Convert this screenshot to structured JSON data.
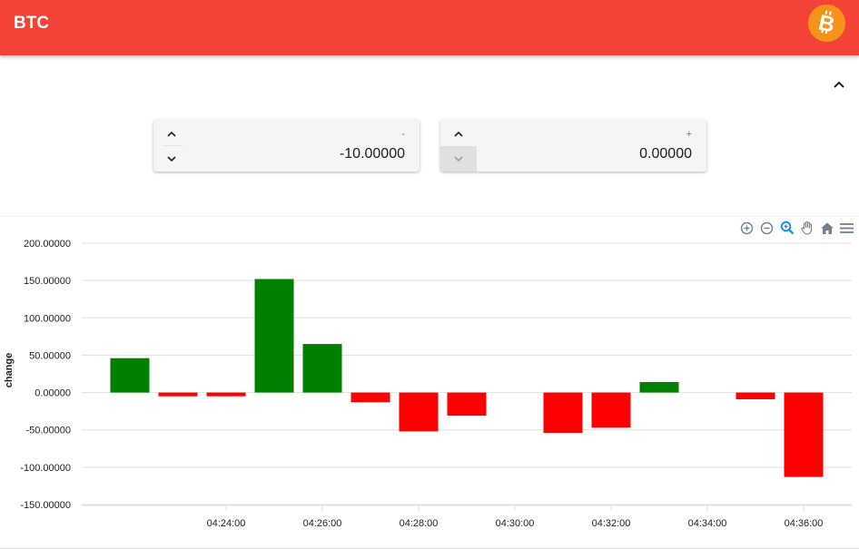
{
  "app": {
    "title": "BTC",
    "logo_icon": "bitcoin-icon",
    "header_color": "#f44336",
    "logo_color": "#f7931a"
  },
  "controls": {
    "collapse_icon": "chevron-up-icon",
    "min_input": {
      "label": "-",
      "value": "-10.00000"
    },
    "max_input": {
      "label": "+",
      "value": "0.00000"
    }
  },
  "toolbar": {
    "icons": [
      "zoom-in-icon",
      "zoom-out-icon",
      "selection-zoom-icon",
      "pan-icon",
      "reset-home-icon",
      "menu-icon"
    ]
  },
  "chart_data": {
    "type": "bar",
    "ylabel": "change",
    "xlabel": "",
    "title": "",
    "grid": true,
    "legend": false,
    "ylim": [
      -150,
      200
    ],
    "y_ticks": [
      "200.00000",
      "150.00000",
      "100.00000",
      "50.00000",
      "0.00000",
      "-50.00000",
      "-100.00000",
      "-150.00000"
    ],
    "y_tick_values": [
      200,
      150,
      100,
      50,
      0,
      -50,
      -100,
      -150
    ],
    "x_ticks": [
      "04:24:00",
      "04:26:00",
      "04:28:00",
      "04:30:00",
      "04:32:00",
      "04:34:00",
      "04:36:00"
    ],
    "x_tick_minutes": [
      24,
      26,
      28,
      30,
      32,
      34,
      36
    ],
    "xlim_minutes": [
      21.0,
      37.0
    ],
    "positive_color": "#008000",
    "negative_color": "#ff0000",
    "bars": [
      {
        "t": "04:22:00",
        "value": 46
      },
      {
        "t": "04:23:00",
        "value": -5
      },
      {
        "t": "04:24:00",
        "value": -5
      },
      {
        "t": "04:25:00",
        "value": 152
      },
      {
        "t": "04:26:00",
        "value": 65
      },
      {
        "t": "04:27:00",
        "value": -13
      },
      {
        "t": "04:28:00",
        "value": -52
      },
      {
        "t": "04:29:00",
        "value": -31
      },
      {
        "t": "04:31:00",
        "value": -54
      },
      {
        "t": "04:32:00",
        "value": -47
      },
      {
        "t": "04:33:00",
        "value": 14
      },
      {
        "t": "04:35:00",
        "value": -9
      },
      {
        "t": "04:36:00",
        "value": -113
      }
    ]
  }
}
